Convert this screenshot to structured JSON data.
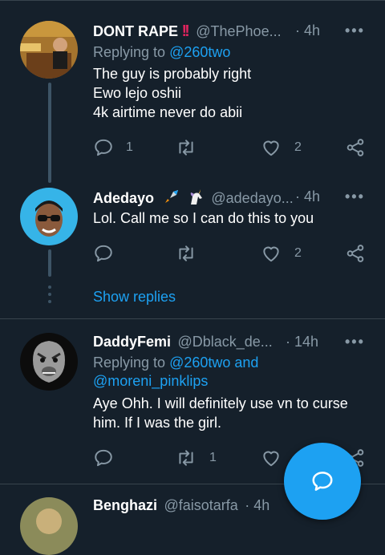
{
  "tweets": [
    {
      "name": "DONT RAPE",
      "handle": "@ThePhoe...",
      "time": "· 4h",
      "more": "•••",
      "replying_prefix": "Replying to ",
      "replying_to": "@260two",
      "body": [
        "The guy is probably right",
        "Ewo lejo oshii",
        "4k airtime never do abii"
      ],
      "reply_count": "1",
      "like_count": "2"
    },
    {
      "name": "Adedayo",
      "handle": "@adedayo...",
      "time": "· 4h",
      "more": "•••",
      "body": [
        "Lol. Call me so I can do this to you"
      ],
      "like_count": "2"
    },
    {
      "name": "DaddyFemi",
      "handle": "@Dblack_de...",
      "time": "· 14h",
      "more": "•••",
      "replying_prefix": "Replying to ",
      "replying_to": "@260two and",
      "replying_to_2": "@moreni_pinklips",
      "body": [
        "Aye Ohh. I will definitely use vn to curse",
        "him. If I was the girl."
      ],
      "retweet_count": "1"
    },
    {
      "name": "Benghazi",
      "handle": "@faisotarfa",
      "time": "· 4h"
    }
  ],
  "show_replies": "Show replies",
  "colors": {
    "background": "#15202b",
    "accent": "#1da1f2",
    "muted": "#8899a6",
    "alert": "#e0245e"
  }
}
